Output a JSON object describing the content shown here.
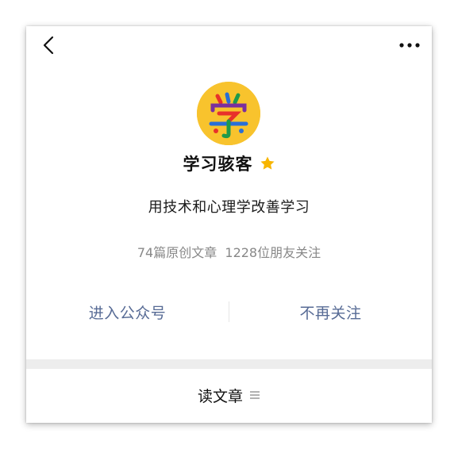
{
  "header": {
    "back_icon": "chevron-left-icon",
    "more_icon": "more-dots-icon"
  },
  "profile": {
    "avatar_text": "学",
    "avatar_bg": "#f8c32d",
    "name": "学习骇客",
    "star_icon": "star-icon",
    "star_color": "#f7b500",
    "bio": "用技术和心理学改善学习",
    "stats": "74篇原创文章  1228位朋友关注"
  },
  "actions": {
    "enter_label": "进入公众号",
    "unfollow_label": "不再关注",
    "link_color": "#576b95"
  },
  "footer": {
    "read_label": "读文章",
    "list_icon": "list-icon"
  }
}
